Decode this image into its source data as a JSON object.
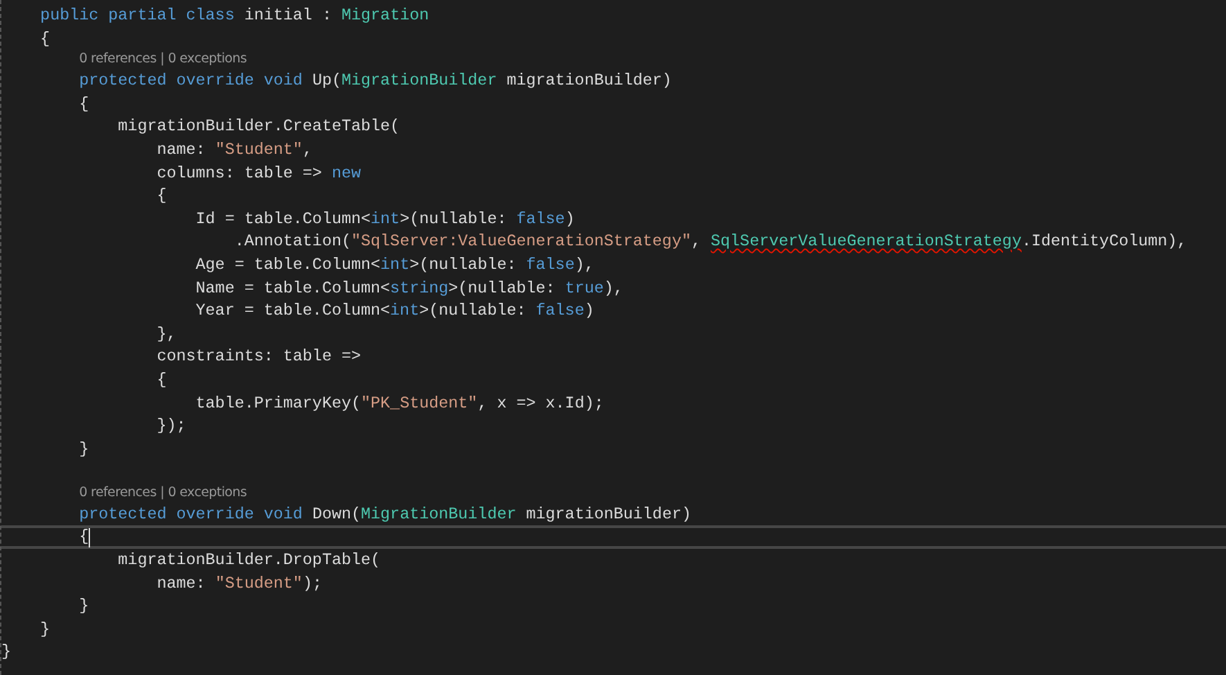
{
  "editor": {
    "lines": [
      {
        "kind": "code",
        "current": false,
        "tokens": [
          {
            "text": "    public partial class ",
            "kind": "keyword"
          },
          {
            "text": "initial",
            "kind": "plain"
          },
          {
            "text": " : ",
            "kind": "plain"
          },
          {
            "text": "Migration",
            "kind": "type"
          }
        ]
      },
      {
        "kind": "code",
        "current": false,
        "tokens": [
          {
            "text": "    {",
            "kind": "plain"
          }
        ]
      },
      {
        "kind": "code",
        "current": false,
        "codelens": "0 references | 0 exceptions",
        "tokens": [
          {
            "text": "        protected override void ",
            "kind": "keyword"
          },
          {
            "text": "Up(",
            "kind": "plain"
          },
          {
            "text": "MigrationBuilder",
            "kind": "type"
          },
          {
            "text": " migrationBuilder)",
            "kind": "plain"
          }
        ]
      },
      {
        "kind": "code",
        "current": false,
        "tokens": [
          {
            "text": "        {",
            "kind": "plain"
          }
        ]
      },
      {
        "kind": "code",
        "current": false,
        "tokens": [
          {
            "text": "            migrationBuilder.CreateTable(",
            "kind": "plain"
          }
        ]
      },
      {
        "kind": "code",
        "current": false,
        "tokens": [
          {
            "text": "                name: ",
            "kind": "plain"
          },
          {
            "text": "\"Student\"",
            "kind": "string"
          },
          {
            "text": ",",
            "kind": "plain"
          }
        ]
      },
      {
        "kind": "code",
        "current": false,
        "tokens": [
          {
            "text": "                columns: table => ",
            "kind": "plain"
          },
          {
            "text": "new",
            "kind": "keyword"
          }
        ]
      },
      {
        "kind": "code",
        "current": false,
        "tokens": [
          {
            "text": "                {",
            "kind": "plain"
          }
        ]
      },
      {
        "kind": "code",
        "current": false,
        "tokens": [
          {
            "text": "                    Id = table.Column<",
            "kind": "plain"
          },
          {
            "text": "int",
            "kind": "keyword"
          },
          {
            "text": ">(nullable: ",
            "kind": "plain"
          },
          {
            "text": "false",
            "kind": "keyword"
          },
          {
            "text": ")",
            "kind": "plain"
          }
        ]
      },
      {
        "kind": "code",
        "current": false,
        "tokens": [
          {
            "text": "                        .Annotation(",
            "kind": "plain"
          },
          {
            "text": "\"SqlServer:ValueGenerationStrategy\"",
            "kind": "string"
          },
          {
            "text": ", ",
            "kind": "plain"
          },
          {
            "text": "SqlServerValueGenerationStrategy",
            "kind": "error"
          },
          {
            "text": ".IdentityColumn),",
            "kind": "plain"
          }
        ]
      },
      {
        "kind": "code",
        "current": false,
        "tokens": [
          {
            "text": "                    Age = table.Column<",
            "kind": "plain"
          },
          {
            "text": "int",
            "kind": "keyword"
          },
          {
            "text": ">(nullable: ",
            "kind": "plain"
          },
          {
            "text": "false",
            "kind": "keyword"
          },
          {
            "text": "),",
            "kind": "plain"
          }
        ]
      },
      {
        "kind": "code",
        "current": false,
        "tokens": [
          {
            "text": "                    Name = table.Column<",
            "kind": "plain"
          },
          {
            "text": "string",
            "kind": "keyword"
          },
          {
            "text": ">(nullable: ",
            "kind": "plain"
          },
          {
            "text": "true",
            "kind": "keyword"
          },
          {
            "text": "),",
            "kind": "plain"
          }
        ]
      },
      {
        "kind": "code",
        "current": false,
        "tokens": [
          {
            "text": "                    Year = table.Column<",
            "kind": "plain"
          },
          {
            "text": "int",
            "kind": "keyword"
          },
          {
            "text": ">(nullable: ",
            "kind": "plain"
          },
          {
            "text": "false",
            "kind": "keyword"
          },
          {
            "text": ")",
            "kind": "plain"
          }
        ]
      },
      {
        "kind": "code",
        "current": false,
        "tokens": [
          {
            "text": "                },",
            "kind": "plain"
          }
        ]
      },
      {
        "kind": "code",
        "current": false,
        "tokens": [
          {
            "text": "                constraints: table =>",
            "kind": "plain"
          }
        ]
      },
      {
        "kind": "code",
        "current": false,
        "tokens": [
          {
            "text": "                {",
            "kind": "plain"
          }
        ]
      },
      {
        "kind": "code",
        "current": false,
        "tokens": [
          {
            "text": "                    table.PrimaryKey(",
            "kind": "plain"
          },
          {
            "text": "\"PK_Student\"",
            "kind": "string"
          },
          {
            "text": ", x => x.Id);",
            "kind": "plain"
          }
        ]
      },
      {
        "kind": "code",
        "current": false,
        "tokens": [
          {
            "text": "                });",
            "kind": "plain"
          }
        ]
      },
      {
        "kind": "code",
        "current": false,
        "tokens": [
          {
            "text": "        }",
            "kind": "plain"
          }
        ]
      },
      {
        "kind": "blank"
      },
      {
        "kind": "code",
        "current": false,
        "codelens": "0 references | 0 exceptions",
        "tokens": [
          {
            "text": "        protected override void ",
            "kind": "keyword"
          },
          {
            "text": "Down(",
            "kind": "plain"
          },
          {
            "text": "MigrationBuilder",
            "kind": "type"
          },
          {
            "text": " migrationBuilder)",
            "kind": "plain"
          }
        ]
      },
      {
        "kind": "code",
        "current": true,
        "tokens": [
          {
            "text": "        {",
            "kind": "plain"
          }
        ]
      },
      {
        "kind": "code",
        "current": false,
        "tokens": [
          {
            "text": "            migrationBuilder.DropTable(",
            "kind": "plain"
          }
        ]
      },
      {
        "kind": "code",
        "current": false,
        "tokens": [
          {
            "text": "                name: ",
            "kind": "plain"
          },
          {
            "text": "\"Student\"",
            "kind": "string"
          },
          {
            "text": ");",
            "kind": "plain"
          }
        ]
      },
      {
        "kind": "code",
        "current": false,
        "tokens": [
          {
            "text": "        }",
            "kind": "plain"
          }
        ]
      },
      {
        "kind": "code",
        "current": false,
        "tokens": [
          {
            "text": "    }",
            "kind": "plain"
          }
        ]
      },
      {
        "kind": "code",
        "current": false,
        "tokens": [
          {
            "text": "}",
            "kind": "plain"
          }
        ]
      }
    ]
  }
}
